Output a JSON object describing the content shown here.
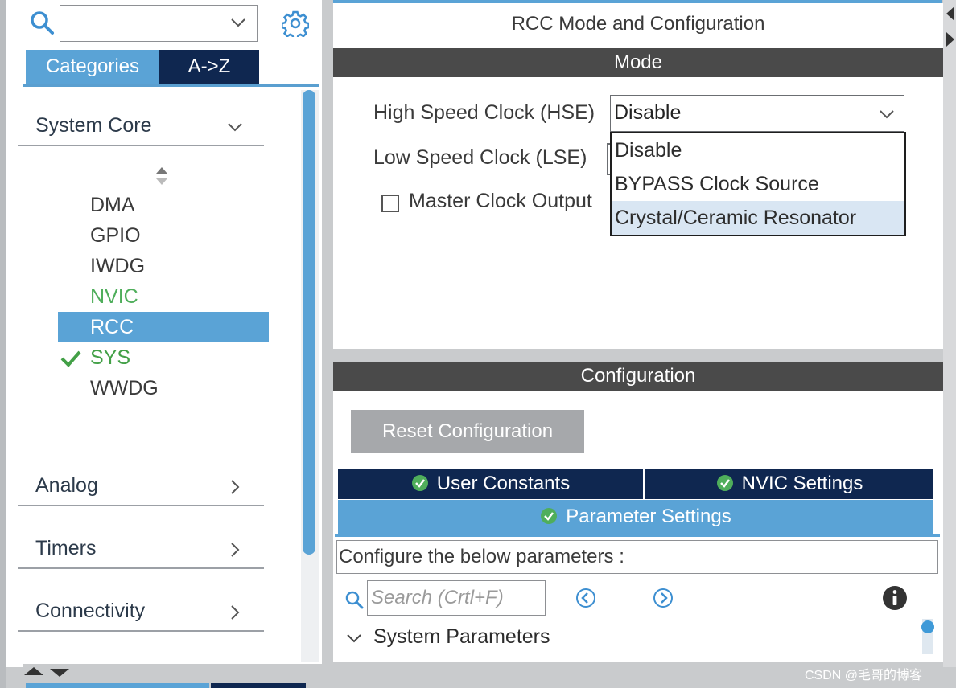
{
  "left": {
    "search_value": "",
    "tabs": [
      "Categories",
      "A->Z"
    ],
    "groups": {
      "system_core": "System Core",
      "analog": "Analog",
      "timers": "Timers",
      "connectivity": "Connectivity"
    },
    "items": [
      "DMA",
      "GPIO",
      "IWDG",
      "NVIC",
      "RCC",
      "SYS",
      "WWDG"
    ],
    "selected_item": "RCC"
  },
  "right": {
    "title": "RCC Mode and Configuration",
    "mode_header": "Mode",
    "hse_label": "High Speed Clock (HSE)",
    "hse_value": "Disable",
    "lse_label": "Low Speed Clock (LSE)",
    "mco_label": "Master Clock Output",
    "mco_checked": false,
    "hse_options": [
      "Disable",
      "BYPASS Clock Source",
      "Crystal/Ceramic Resonator"
    ],
    "hovered_option": "Crystal/Ceramic Resonator",
    "config_header": "Configuration",
    "reset_button": "Reset Configuration",
    "tabs": {
      "user_constants": "User Constants",
      "nvic_settings": "NVIC Settings",
      "parameter_settings": "Parameter Settings"
    },
    "param_description": "Configure the below parameters :",
    "search_placeholder": "Search (Crtl+F)",
    "section_label": "System Parameters"
  },
  "colors": {
    "accent_blue": "#5aa3d6",
    "dark_navy": "#0f2750",
    "section_bar": "#4a4a4a",
    "nvic_green": "#4fae5b",
    "check_green": "#43a047"
  },
  "watermark": "CSDN @毛哥的博客"
}
